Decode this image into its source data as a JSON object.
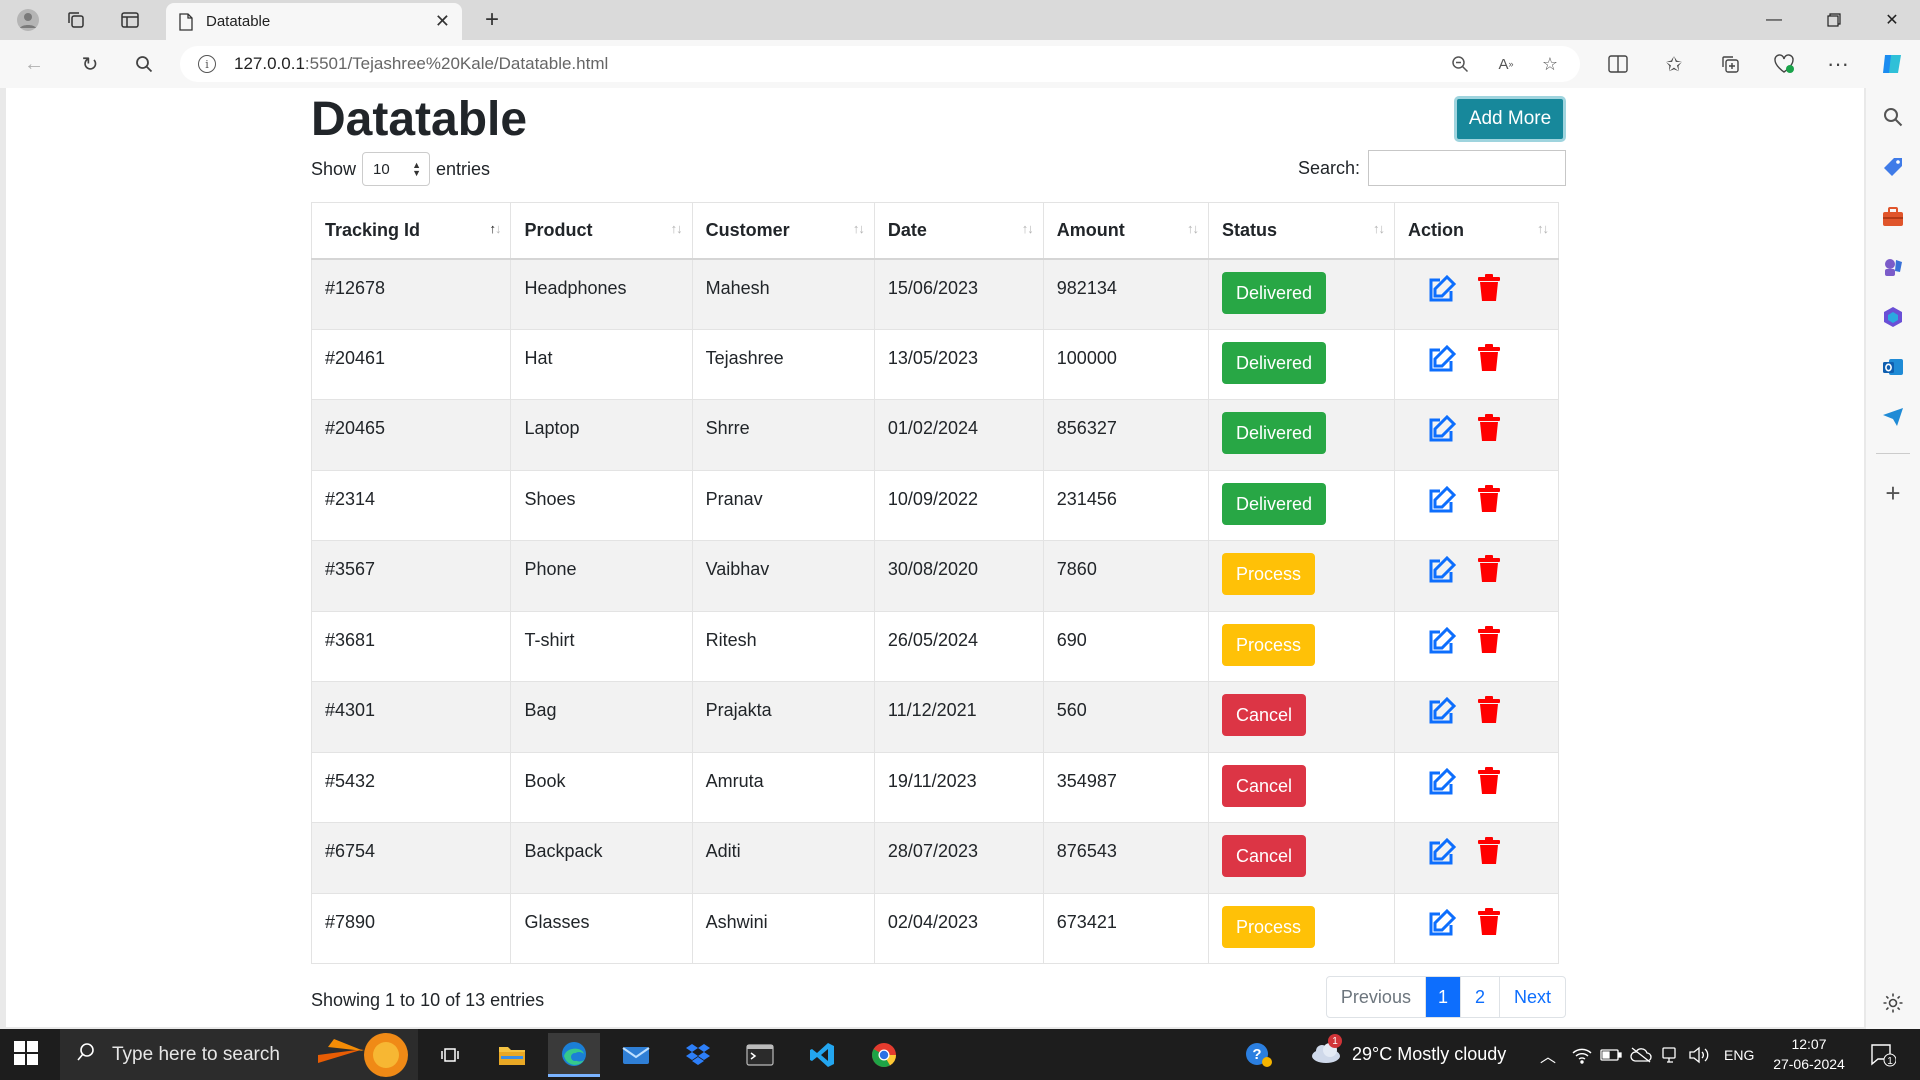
{
  "browser": {
    "tab_title": "Datatable",
    "url_host": "127.0.0.1",
    "url_rest": ":5501/Tejashree%20Kale/Datatable.html"
  },
  "page": {
    "title": "Datatable",
    "add_button": "Add More",
    "show_label": "Show",
    "entries_value": "10",
    "entries_label": "entries",
    "search_label": "Search:",
    "columns": [
      "Tracking Id",
      "Product",
      "Customer",
      "Date",
      "Amount",
      "Status",
      "Action"
    ],
    "rows": [
      {
        "id": "#12678",
        "product": "Headphones",
        "customer": "Mahesh",
        "date": "15/06/2023",
        "amount": "982134",
        "status": "Delivered"
      },
      {
        "id": "#20461",
        "product": "Hat",
        "customer": "Tejashree",
        "date": "13/05/2023",
        "amount": "100000",
        "status": "Delivered"
      },
      {
        "id": "#20465",
        "product": "Laptop",
        "customer": "Shrre",
        "date": "01/02/2024",
        "amount": "856327",
        "status": "Delivered"
      },
      {
        "id": "#2314",
        "product": "Shoes",
        "customer": "Pranav",
        "date": "10/09/2022",
        "amount": "231456",
        "status": "Delivered"
      },
      {
        "id": "#3567",
        "product": "Phone",
        "customer": "Vaibhav",
        "date": "30/08/2020",
        "amount": "7860",
        "status": "Process"
      },
      {
        "id": "#3681",
        "product": "T-shirt",
        "customer": "Ritesh",
        "date": "26/05/2024",
        "amount": "690",
        "status": "Process"
      },
      {
        "id": "#4301",
        "product": "Bag",
        "customer": "Prajakta",
        "date": "11/12/2021",
        "amount": "560",
        "status": "Cancel"
      },
      {
        "id": "#5432",
        "product": "Book",
        "customer": "Amruta",
        "date": "19/11/2023",
        "amount": "354987",
        "status": "Cancel"
      },
      {
        "id": "#6754",
        "product": "Backpack",
        "customer": "Aditi",
        "date": "28/07/2023",
        "amount": "876543",
        "status": "Cancel"
      },
      {
        "id": "#7890",
        "product": "Glasses",
        "customer": "Ashwini",
        "date": "02/04/2023",
        "amount": "673421",
        "status": "Process"
      }
    ],
    "info": "Showing 1 to 10 of 13 entries",
    "pager": {
      "prev": "Previous",
      "page1": "1",
      "page2": "2",
      "next": "Next"
    },
    "status_colors": {
      "Delivered": "#28a745",
      "Process": "#ffc107",
      "Cancel": "#dc3545"
    }
  },
  "taskbar": {
    "search_placeholder": "Type here to search",
    "weather": "29°C  Mostly cloudy",
    "language": "ENG",
    "time": "12:07",
    "date": "27-06-2024",
    "notification_count": "1"
  }
}
